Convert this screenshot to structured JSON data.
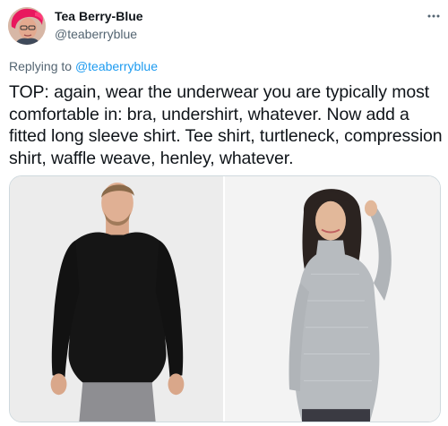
{
  "author": {
    "display_name": "Tea Berry-Blue",
    "handle": "@teaberryblue",
    "avatar_icon": "user-avatar"
  },
  "reply": {
    "prefix": "Replying to ",
    "mention": "@teaberryblue"
  },
  "tweet": {
    "text": "TOP: again, wear the underwear you are typically most comfortable in: bra, undershirt, whatever. Now add a fitted long sleeve shirt. Tee shirt, turtleneck, compression shirt, waffle weave, henley, whatever."
  },
  "media": {
    "photos": [
      {
        "subject": "man in black fitted long sleeve shirt"
      },
      {
        "subject": "woman in grey fitted turtleneck"
      }
    ]
  },
  "icons": {
    "more": "more-options-icon"
  },
  "colors": {
    "link": "#1d9bf0",
    "secondary_text": "#536471",
    "primary_text": "#0f1419",
    "border": "#cfd9de"
  }
}
